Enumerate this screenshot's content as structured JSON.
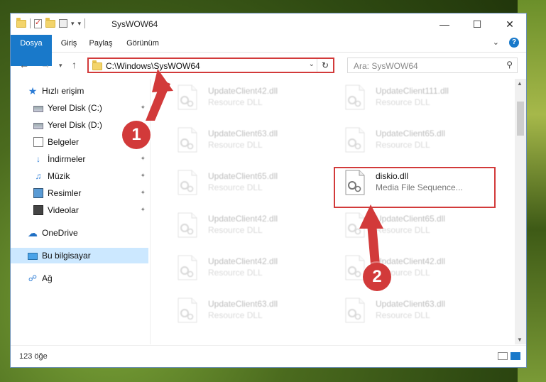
{
  "window": {
    "title": "SysWOW64"
  },
  "ribbon": {
    "tabs": [
      "Dosya",
      "Giriş",
      "Paylaş",
      "Görünüm"
    ]
  },
  "address": {
    "path": "C:\\Windows\\SysWOW64"
  },
  "search": {
    "placeholder": "Ara: SysWOW64"
  },
  "sidebar": {
    "items": [
      {
        "label": "Hızlı erişim",
        "icon": "star-icon"
      },
      {
        "label": "Yerel Disk (C:)",
        "icon": "disk-icon"
      },
      {
        "label": "Yerel Disk (D:)",
        "icon": "disk-icon"
      },
      {
        "label": "Belgeler",
        "icon": "document-icon"
      },
      {
        "label": "İndirmeler",
        "icon": "download-icon"
      },
      {
        "label": "Müzik",
        "icon": "music-icon"
      },
      {
        "label": "Resimler",
        "icon": "pictures-icon"
      },
      {
        "label": "Videolar",
        "icon": "video-icon"
      },
      {
        "label": "OneDrive",
        "icon": "cloud-icon"
      },
      {
        "label": "Bu bilgisayar",
        "icon": "computer-icon"
      },
      {
        "label": "Ağ",
        "icon": "network-icon"
      }
    ]
  },
  "files": {
    "col1": [
      {
        "name": "UpdateClient42.dll",
        "type": "Resource DLL"
      },
      {
        "name": "UpdateClient63.dll",
        "type": "Resource DLL"
      },
      {
        "name": "UpdateClient65.dll",
        "type": "Resource DLL"
      },
      {
        "name": "UpdateClient42.dll",
        "type": "Resource DLL"
      },
      {
        "name": "UpdateClient42.dll",
        "type": "Resource DLL"
      },
      {
        "name": "UpdateClient63.dll",
        "type": "Resource DLL"
      }
    ],
    "col2": [
      {
        "name": "UpdateClient111.dll",
        "type": "Resource DLL"
      },
      {
        "name": "UpdateClient65.dll",
        "type": "Resource DLL"
      },
      {
        "name": "diskio.dll",
        "type": "Media File Sequence..."
      },
      {
        "name": "UpdateClient65.dll",
        "type": "Resource DLL"
      },
      {
        "name": "UpdateClient42.dll",
        "type": "Resource DLL"
      },
      {
        "name": "UpdateClient63.dll",
        "type": "Resource DLL"
      }
    ]
  },
  "status": {
    "count": "123 öğe"
  },
  "callouts": [
    "1",
    "2"
  ],
  "colors": {
    "accent": "#1979ca",
    "annotation": "#d23a3a",
    "selected": "#cce8ff"
  }
}
